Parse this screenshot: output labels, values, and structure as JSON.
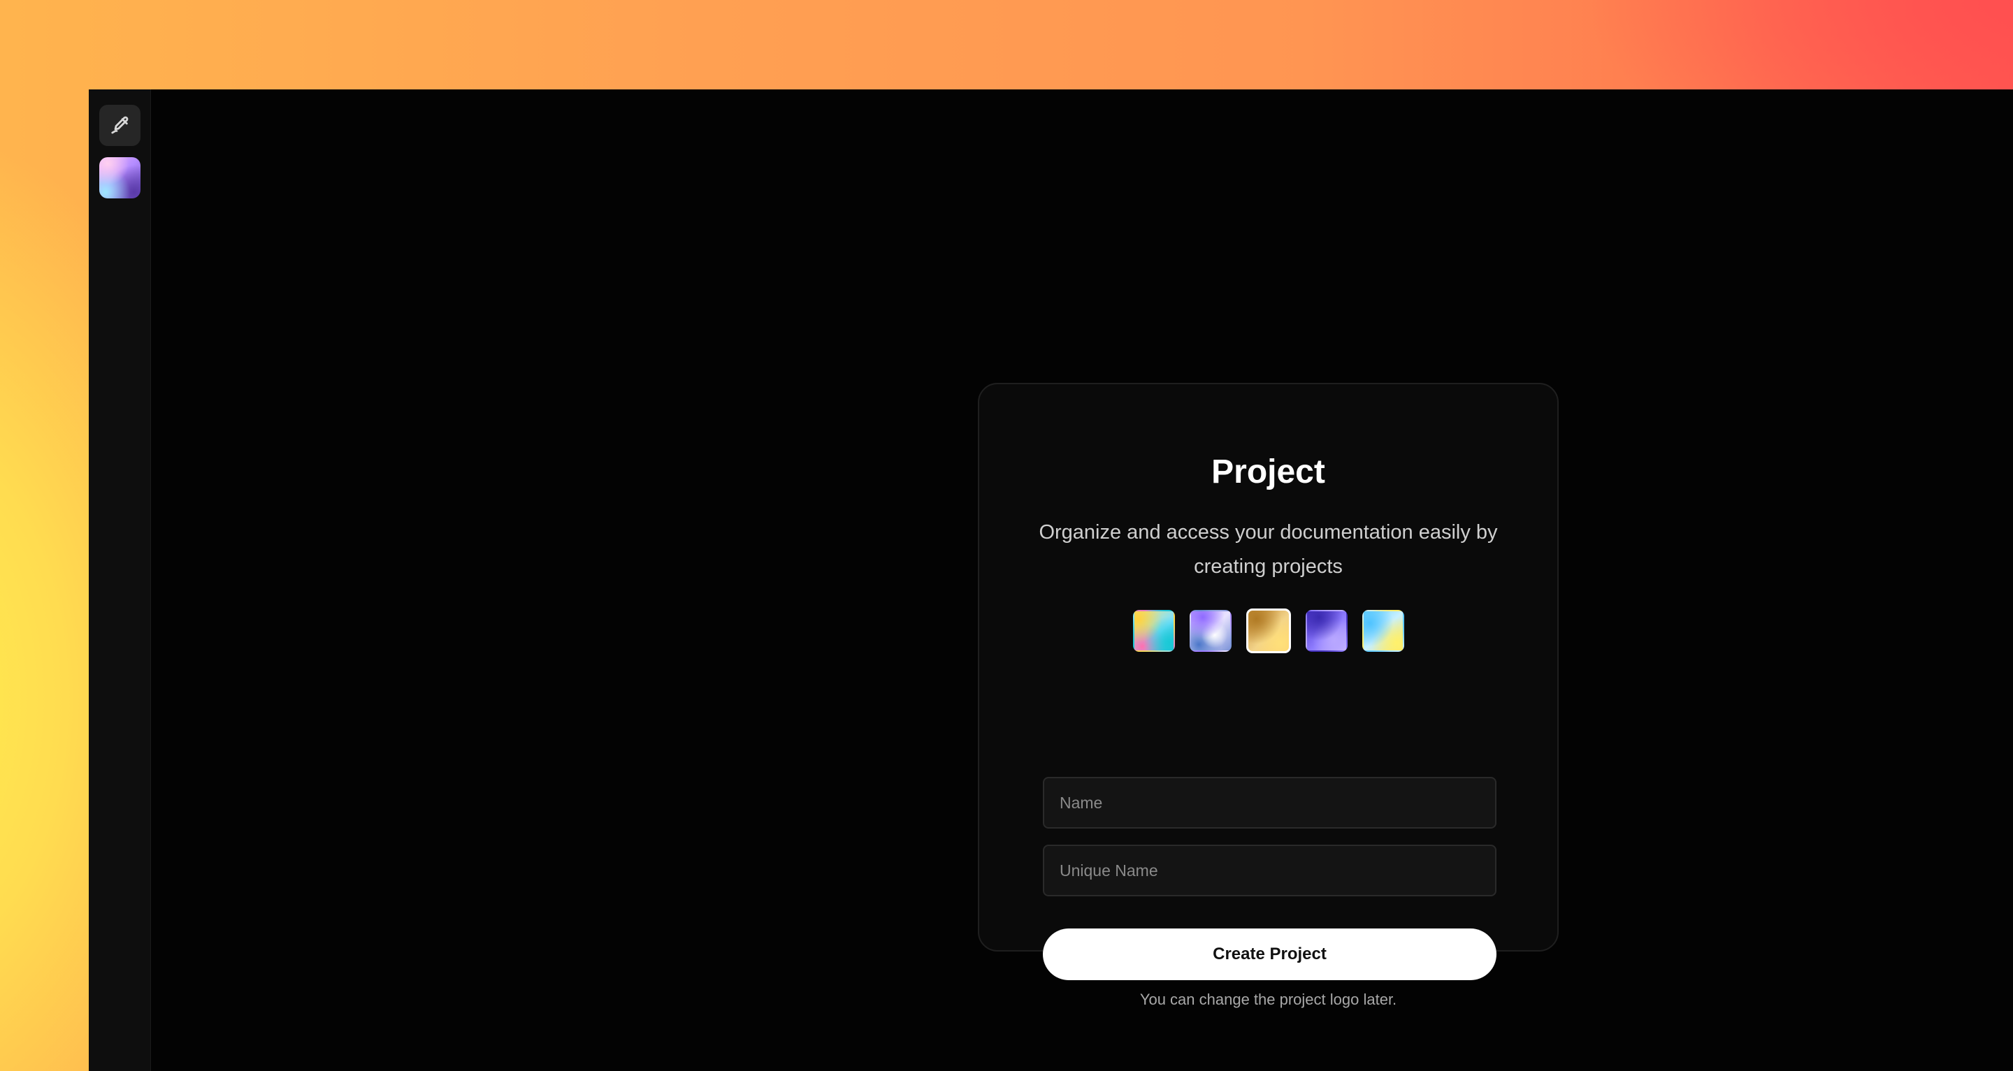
{
  "sidebar": {
    "items": [
      {
        "icon": "pen-edit-icon"
      },
      {
        "icon": "project-logo-icon"
      }
    ]
  },
  "card": {
    "title": "Project",
    "subtitle": "Organize and access your documentation easily by creating projects",
    "logos": [
      {
        "name": "gradient-logo-1",
        "selected": false
      },
      {
        "name": "gradient-logo-2",
        "selected": false
      },
      {
        "name": "gradient-logo-3",
        "selected": true
      },
      {
        "name": "gradient-logo-4",
        "selected": false
      },
      {
        "name": "gradient-logo-5",
        "selected": false
      }
    ],
    "name_field": {
      "value": "",
      "placeholder": "Name"
    },
    "unique_name_field": {
      "value": "",
      "placeholder": "Unique Name"
    },
    "create_button_label": "Create Project"
  },
  "hint": "You can change the project logo later.",
  "colors": {
    "app_background": "#030303",
    "card_background": "#0a0a0a",
    "button_background": "#ffffff"
  }
}
